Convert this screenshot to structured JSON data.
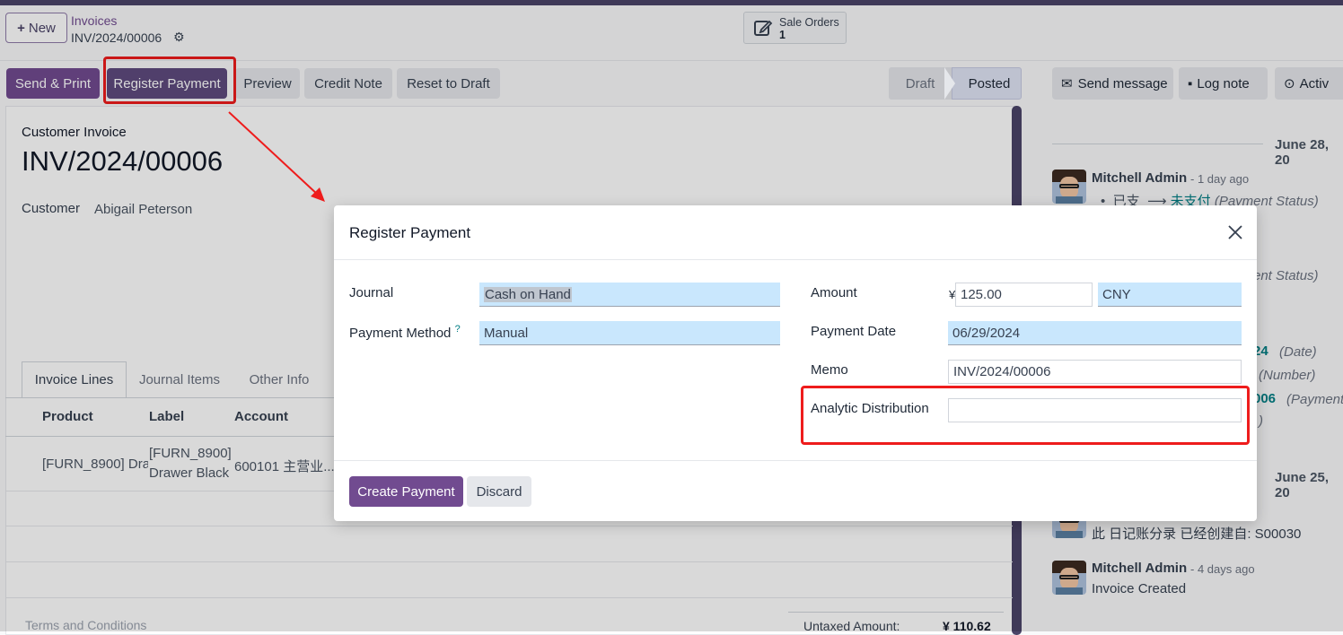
{
  "control_panel": {
    "new_label": "New",
    "breadcrumb_parent": "Invoices",
    "breadcrumb_current": "INV/2024/00006",
    "smart_button": {
      "label": "Sale Orders",
      "count": "1"
    }
  },
  "toolbar": {
    "send_print": "Send & Print",
    "register_payment": "Register Payment",
    "preview": "Preview",
    "credit_note": "Credit Note",
    "reset_to_draft": "Reset to Draft"
  },
  "statusbar": {
    "draft": "Draft",
    "posted": "Posted"
  },
  "invoice": {
    "type": "Customer Invoice",
    "number": "INV/2024/00006",
    "customer_label": "Customer",
    "customer_value": "Abigail Peterson",
    "tabs": [
      "Invoice Lines",
      "Journal Items",
      "Other Info"
    ],
    "columns": [
      "Product",
      "Label",
      "Account"
    ],
    "row": {
      "product": "[FURN_8900] Drav",
      "label_line1": "[FURN_8900]",
      "label_line2": "Drawer Black",
      "account": "600101 主营业..."
    },
    "terms": "Terms and Conditions",
    "untaxed_label": "Untaxed Amount:",
    "untaxed_value": "¥ 110.62"
  },
  "chatter": {
    "send_message": "Send message",
    "log_note": "Log note",
    "activities": "Activ",
    "date1": "June 28, 20",
    "date2": "June 25, 20",
    "msg1_author": "Mitchell Admin",
    "msg1_time": "- 1 day ago",
    "msg1_line_from": "已支",
    "msg1_line_to": "未支付",
    "msg1_field": "(Payment Status)",
    "frag_status": "ent Status)",
    "frag_24": "24",
    "frag_date": "(Date)",
    "frag_number": "(Number)",
    "frag_006": "006",
    "frag_payment": "(Payment",
    "frag_paren": ")",
    "msg_chinese": "此 日记账分录 已经创建自: S00030",
    "msg3_author": "Mitchell Admin",
    "msg3_time": "- 4 days ago",
    "msg3_body": "Invoice Created"
  },
  "modal": {
    "title": "Register Payment",
    "journal_label": "Journal",
    "journal_value": "Cash on Hand",
    "payment_method_label": "Payment Method",
    "payment_method_help": "?",
    "payment_method_value": "Manual",
    "amount_label": "Amount",
    "currency_symbol": "¥",
    "amount_value": "125.00",
    "currency_value": "CNY",
    "payment_date_label": "Payment Date",
    "payment_date_value": "06/29/2024",
    "memo_label": "Memo",
    "memo_value": "INV/2024/00006",
    "analytic_label": "Analytic Distribution",
    "analytic_value": "",
    "create_payment": "Create Payment",
    "discard": "Discard"
  },
  "colors": {
    "primary": "#714b90",
    "topbar": "#4b4468",
    "highlight_field": "#c9e7fd",
    "annotation_red": "#ee1c1c"
  }
}
